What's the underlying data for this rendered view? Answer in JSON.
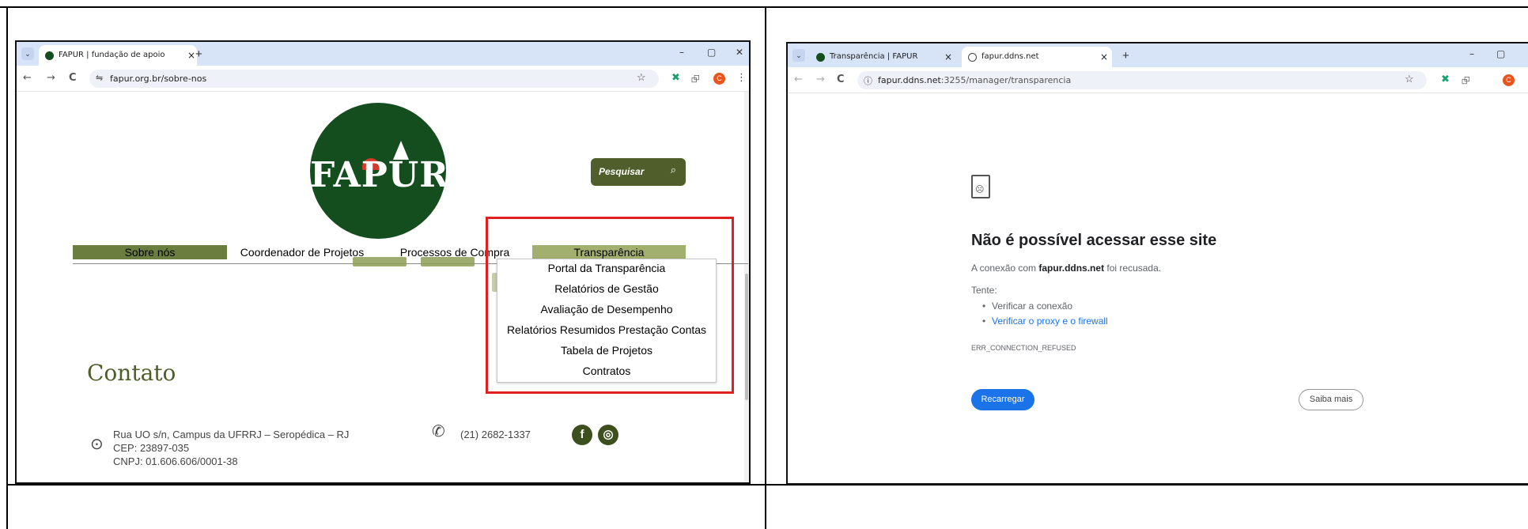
{
  "left_window": {
    "tab": {
      "title": "FAPUR | fundação de apoio",
      "close": "×"
    },
    "new_tab": "+",
    "controls": {
      "minimize": "–",
      "maximize": "▢",
      "close": "✕"
    },
    "tab_menu": "⌄",
    "url": "fapur.org.br/sobre-nos",
    "logo_text": "FAPUR",
    "search_label": "Pesquisar",
    "menu": [
      "Sobre nós",
      "Coordenador de Projetos",
      "Processos de Compra",
      "Transparência"
    ],
    "dropdown": [
      "Portal da Transparência",
      "Relatórios de Gestão",
      "Avaliação de Desempenho",
      "Relatórios Resumidos Prestação Contas",
      "Tabela de Projetos",
      "Contratos"
    ],
    "contact": {
      "heading": "Contato",
      "address": [
        "Rua UO s/n, Campus da UFRRJ – Seropédica – RJ",
        "CEP: 23897-035",
        "CNPJ: 01.606.606/0001-38"
      ],
      "phone": "(21) 2682-1337"
    },
    "profile_initial": "C",
    "icons": {
      "back": "←",
      "forward": "→",
      "reload": "C",
      "site_info": "⇋",
      "star": "☆",
      "extension": "✖",
      "puzzle": "⮺",
      "kebab": "⋮",
      "pin": "⊙",
      "phone": "✆",
      "facebook": "f",
      "instagram": "◎",
      "search": "⌕"
    }
  },
  "right_window": {
    "tabs": [
      {
        "title": "Transparência | FAPUR",
        "close": "×"
      },
      {
        "title": "fapur.ddns.net",
        "close": "×"
      }
    ],
    "new_tab": "+",
    "controls": {
      "minimize": "–",
      "maximize": "▢"
    },
    "tab_menu": "⌄",
    "url_host": "fapur.ddns.net",
    "url_rest": ":3255/manager/transparencia",
    "error": {
      "title": "Não é possível acessar esse site",
      "desc_prefix": "A conexão com ",
      "desc_host": "fapur.ddns.net",
      "desc_suffix": " foi recusada.",
      "try": "Tente:",
      "suggestions": [
        "Verificar a conexão",
        "Verificar o proxy e o firewall"
      ],
      "code": "ERR_CONNECTION_REFUSED",
      "reload_button": "Recarregar",
      "more_button": "Saiba mais",
      "face": "☹"
    },
    "profile_initial": "C",
    "icons": {
      "back": "←",
      "forward": "→",
      "reload": "C",
      "site_info": "ⓘ",
      "star": "☆",
      "extension": "✖",
      "puzzle": "⮺"
    }
  },
  "colors": {
    "logo_green": "#144d1e",
    "olive": "#4f5e2b",
    "highlight_red": "#e02020",
    "chrome_blue": "#1a73e8",
    "link_blue": "#1a73e8"
  }
}
